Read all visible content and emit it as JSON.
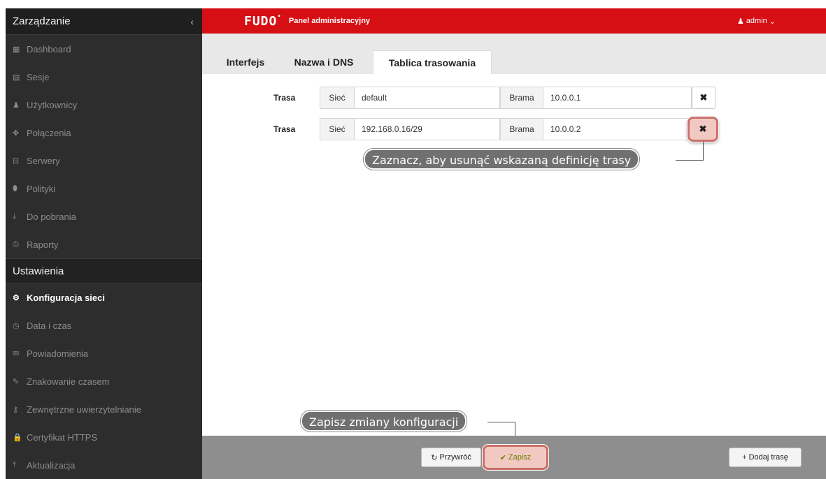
{
  "sidebar": {
    "header": "Zarządzanie",
    "collapse_icon": "‹",
    "management_items": [
      {
        "icon": "▦",
        "label": "Dashboard"
      },
      {
        "icon": "▤",
        "label": "Sesje"
      },
      {
        "icon": "♟",
        "label": "Użytkownicy"
      },
      {
        "icon": "✥",
        "label": "Połączenia"
      },
      {
        "icon": "⊟",
        "label": "Serwery"
      },
      {
        "icon": "⬮",
        "label": "Polityki"
      },
      {
        "icon": "⤓",
        "label": "Do pobrania"
      },
      {
        "icon": "⎙",
        "label": "Raporty"
      }
    ],
    "settings_header": "Ustawienia",
    "settings_items": [
      {
        "icon": "⚙",
        "label": "Konfiguracja sieci"
      },
      {
        "icon": "◷",
        "label": "Data i czas"
      },
      {
        "icon": "✉",
        "label": "Powiadomienia"
      },
      {
        "icon": "✎",
        "label": "Znakowanie czasem"
      },
      {
        "icon": "⚷",
        "label": "Zewnętrzne uwierzytelnianie"
      },
      {
        "icon": "🔒",
        "label": "Certyfikat HTTPS"
      },
      {
        "icon": "⤒",
        "label": "Aktualizacja"
      }
    ]
  },
  "topbar": {
    "logo": "FUDO",
    "logo_dot": "•",
    "subtitle": "Panel administracyjny",
    "user_icon": "♟",
    "user": "admin",
    "user_caret": "⌄"
  },
  "tabs": [
    {
      "label": "Interfejs"
    },
    {
      "label": "Nazwa i DNS"
    },
    {
      "label": "Tablica trasowania"
    }
  ],
  "routes": [
    {
      "label": "Trasa",
      "network_addon": "Sieć",
      "network": "default",
      "gateway_addon": "Brama",
      "gateway": "10.0.0.1",
      "delete_icon": "✖"
    },
    {
      "label": "Trasa",
      "network_addon": "Sieć",
      "network": "192.168.0.16/29",
      "gateway_addon": "Brama",
      "gateway": "10.0.0.2",
      "delete_icon": "✖"
    }
  ],
  "callouts": {
    "delete_hint": "Zaznacz, aby usunąć wskazaną definicję trasy",
    "save_hint": "Zapisz zmiany konfiguracji"
  },
  "footer": {
    "revert_icon": "↻",
    "revert": "Przywróć",
    "save_icon": "✔",
    "save": "Zapisz",
    "add_icon": "+",
    "add_route": "Dodaj trasę"
  },
  "colors": {
    "brand_red": "#d60f14",
    "sidebar_bg": "#2d2d2d",
    "highlight": "#c9706a"
  }
}
